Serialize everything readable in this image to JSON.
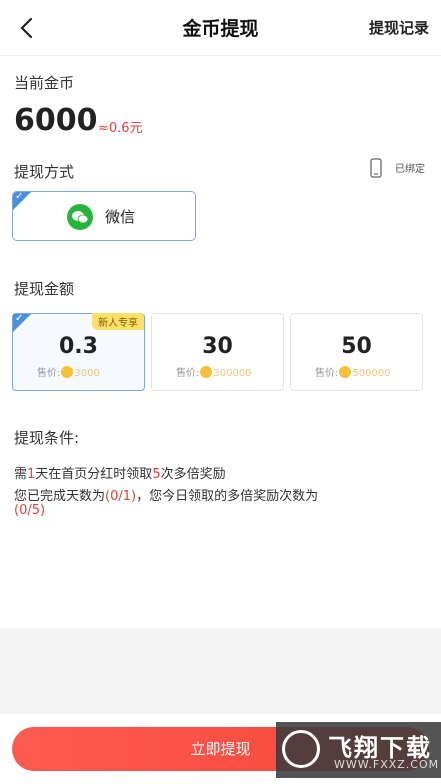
{
  "header": {
    "title": "金币提现",
    "records_label": "提现记录"
  },
  "balance": {
    "label": "当前金币",
    "coins": "6000",
    "approx": "≈0.6元"
  },
  "method": {
    "label": "提现方式",
    "bound_status": "已绑定",
    "option_label": "微信"
  },
  "amounts": {
    "label": "提现金额",
    "new_user_tag": "新人专享",
    "price_prefix": "售价:",
    "items": [
      {
        "value": "0.3",
        "price": "3000",
        "selected": true
      },
      {
        "value": "30",
        "price": "300000",
        "selected": false
      },
      {
        "value": "50",
        "price": "500000",
        "selected": false
      }
    ]
  },
  "conditions": {
    "title": "提现条件:",
    "line1_a": "需",
    "line1_num1": "1",
    "line1_b": "天在首页分红时领取",
    "line1_num2": "5",
    "line1_c": "次多倍奖励",
    "line2_a": "您已完成天数为",
    "line2_red": "(0/1)",
    "line2_b": "，您今日领取的多倍奖励次数为",
    "line3_red": "(0/5)"
  },
  "submit_label": "立即提现",
  "watermark": {
    "text": "飞翔下载",
    "url": "WWW.FXXZ.COM"
  },
  "colors": {
    "accent_red": "#f4473c",
    "wechat_green": "#27b43c",
    "selected_border": "#7fa8d8"
  }
}
